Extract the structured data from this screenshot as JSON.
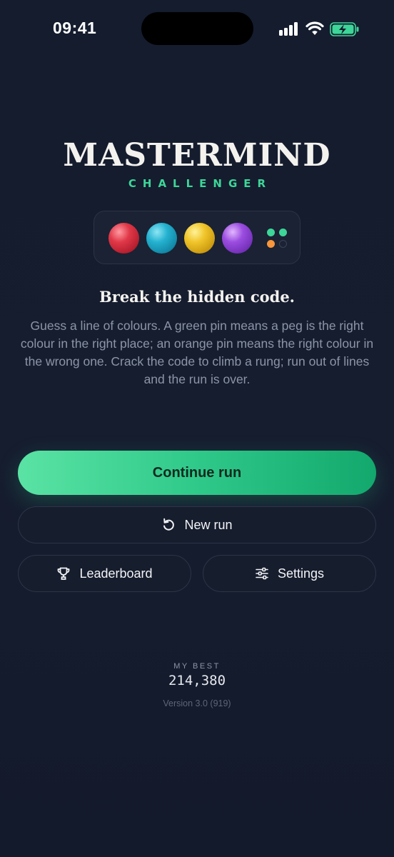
{
  "status_bar": {
    "time": "09:41"
  },
  "app": {
    "title": "MASTERMIND",
    "subtitle": "CHALLENGER"
  },
  "preview": {
    "pegs": [
      "red",
      "teal",
      "yellow",
      "purple"
    ],
    "feedback_pins": [
      "green",
      "green",
      "orange",
      "empty"
    ],
    "colors": {
      "green_pin": "#3dd598",
      "orange_pin": "#f7963a"
    }
  },
  "intro": {
    "headline": "Break the hidden code.",
    "description": "Guess a line of colours. A green pin means a peg is the right colour in the right place; an orange pin means the right colour in the wrong one. Crack the code to climb a rung; run out of lines and the run is over."
  },
  "actions": {
    "continue_label": "Continue run",
    "new_run_label": "New run",
    "new_run_icon": "restart-icon",
    "leaderboard_label": "Leaderboard",
    "leaderboard_icon": "trophy-icon",
    "settings_label": "Settings",
    "settings_icon": "sliders-icon"
  },
  "stats": {
    "best_label": "MY BEST",
    "best_value": "214,380"
  },
  "footer": {
    "version": "Version 3.0 (919)"
  },
  "theme": {
    "accent": "#3dd598",
    "background": "#151c2e"
  }
}
